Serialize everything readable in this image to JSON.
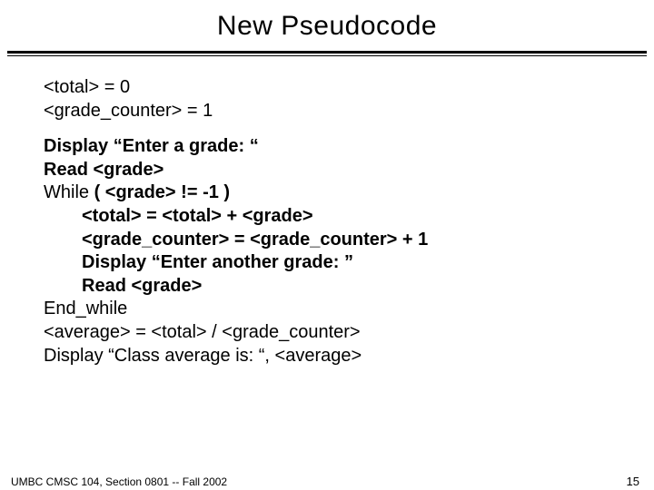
{
  "title": "New Pseudocode",
  "init": {
    "l1": "<total> = 0",
    "l2": "<grade_counter> = 1"
  },
  "code": {
    "l1": "Display “Enter a grade: “",
    "l2": "Read <grade>",
    "l3a": "While",
    "l3b": "  ( <grade>  !=  -1 )",
    "l4": "<total> = <total> + <grade>",
    "l5": "<grade_counter> = <grade_counter> + 1",
    "l6": "Display “Enter another grade: ”",
    "l7": "Read <grade>",
    "l8": "End_while",
    "l9": "<average> = <total> / <grade_counter>",
    "l10": "Display “Class average is: “, <average>"
  },
  "footer": {
    "left": "UMBC CMSC 104, Section 0801 -- Fall 2002",
    "right": "15"
  }
}
